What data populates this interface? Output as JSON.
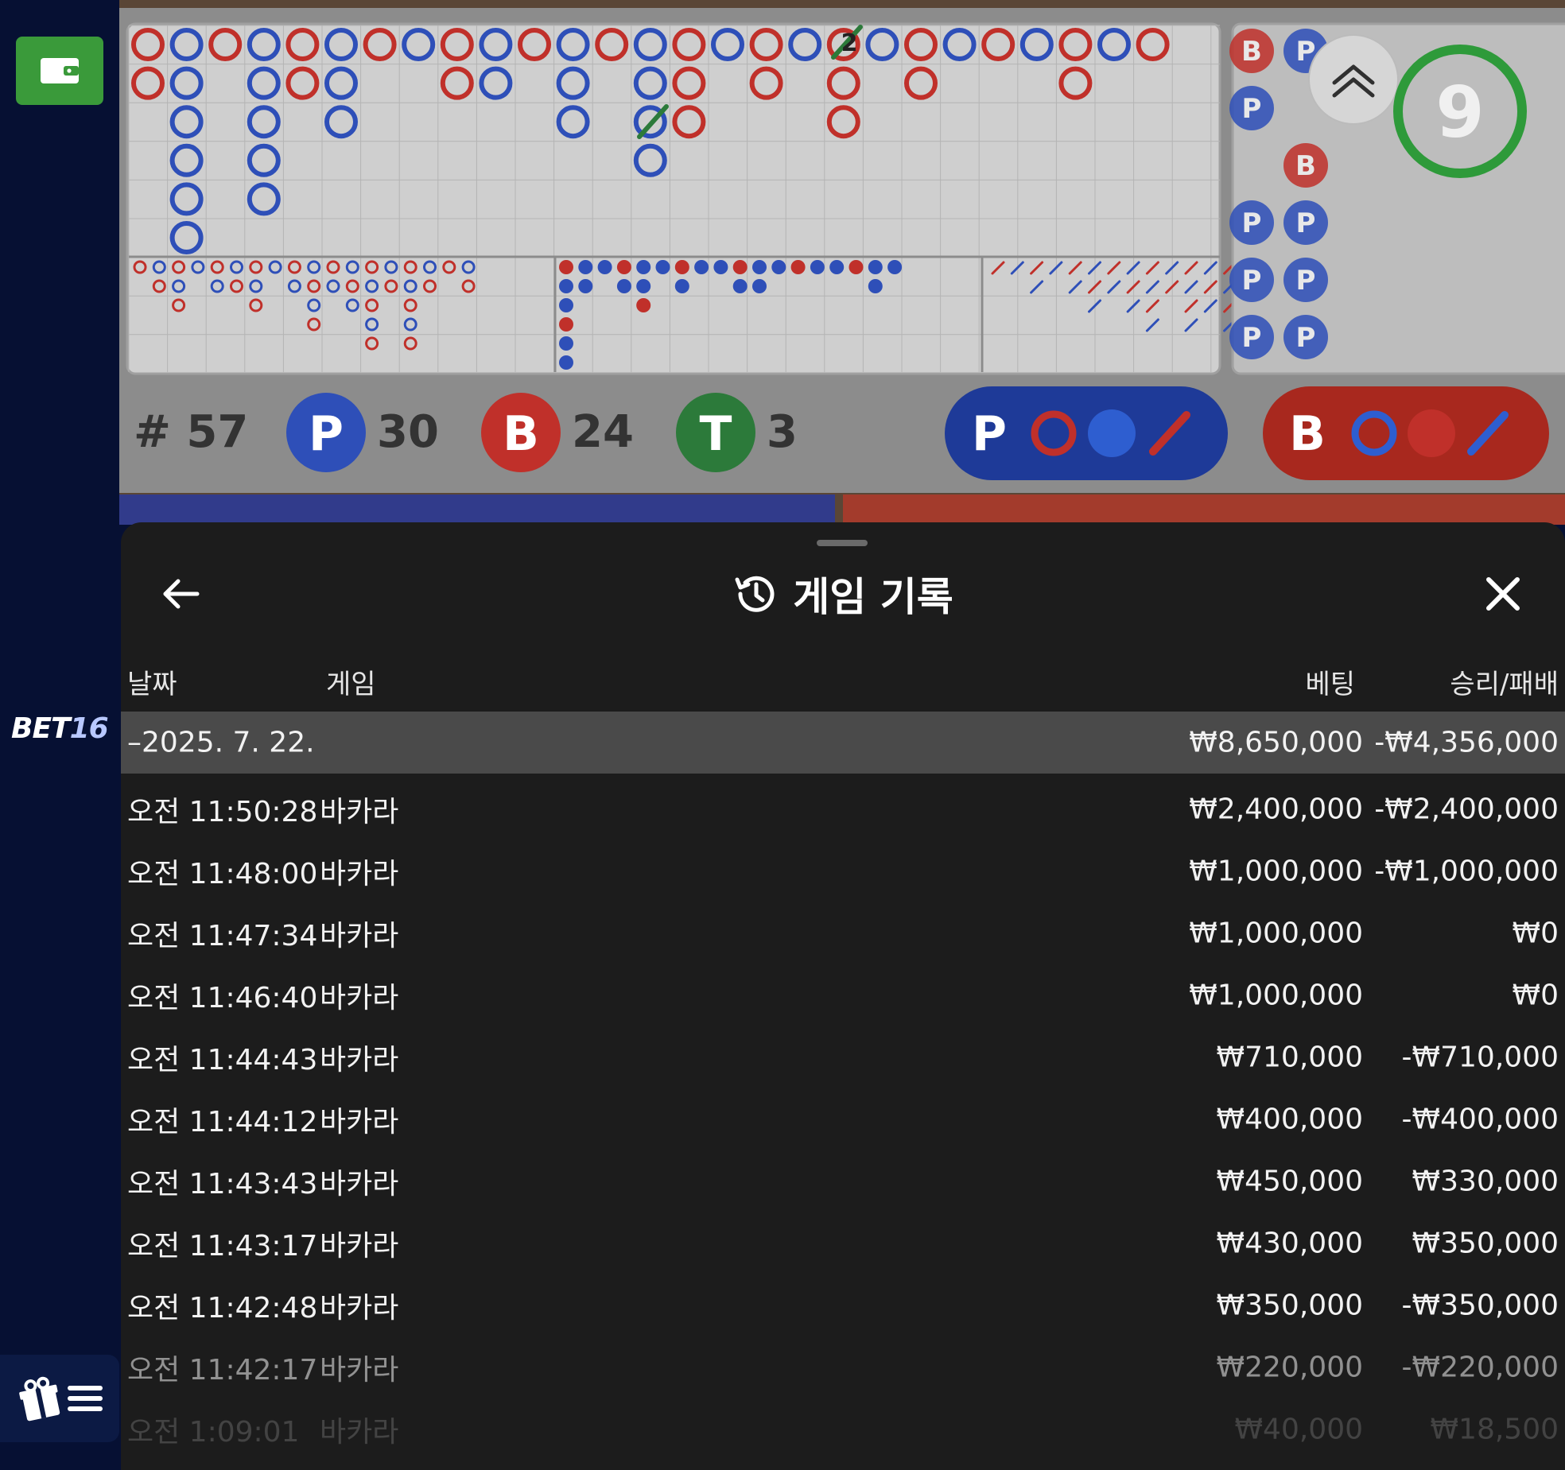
{
  "brand": {
    "name": "BET",
    "number": "16"
  },
  "icons": {
    "wallet": "wallet-icon",
    "promo": "gift-icon",
    "menu": "hamburger-menu-icon",
    "back": "arrow-left-icon",
    "history": "history-clock-icon",
    "close": "close-icon",
    "expand": "chevron-double-up-icon"
  },
  "colors": {
    "player": "#2e4fb8",
    "banker": "#c0302a",
    "tie": "#2c7a3a",
    "wallet": "#3a9a3a",
    "sheet_bg": "#1c1c1c"
  },
  "scoreboard": {
    "round_label": "# 57",
    "player": {
      "letter": "P",
      "count": "30"
    },
    "banker": {
      "letter": "B",
      "count": "24"
    },
    "tie": {
      "letter": "T",
      "count": "3"
    },
    "player_predict": {
      "letter": "P"
    },
    "banker_predict": {
      "letter": "B"
    },
    "timer": "9",
    "tie_count_mark": "2",
    "side_road": [
      "B",
      "P",
      "P",
      "B",
      "P",
      "P",
      "P",
      "P",
      "P",
      "P"
    ]
  },
  "history": {
    "title": "게임 기록",
    "columns": {
      "date": "날짜",
      "game": "게임",
      "bet": "베팅",
      "result": "승리/패배"
    },
    "summary": {
      "date": "–2025. 7. 22.",
      "bet": "₩8,650,000",
      "result": "-₩4,356,000"
    },
    "rows": [
      {
        "time": "오전 11:50:28",
        "game": "바카라",
        "bet": "₩2,400,000",
        "result": "-₩2,400,000"
      },
      {
        "time": "오전 11:48:00",
        "game": "바카라",
        "bet": "₩1,000,000",
        "result": "-₩1,000,000"
      },
      {
        "time": "오전 11:47:34",
        "game": "바카라",
        "bet": "₩1,000,000",
        "result": "₩0"
      },
      {
        "time": "오전 11:46:40",
        "game": "바카라",
        "bet": "₩1,000,000",
        "result": "₩0"
      },
      {
        "time": "오전 11:44:43",
        "game": "바카라",
        "bet": "₩710,000",
        "result": "-₩710,000"
      },
      {
        "time": "오전 11:44:12",
        "game": "바카라",
        "bet": "₩400,000",
        "result": "-₩400,000"
      },
      {
        "time": "오전 11:43:43",
        "game": "바카라",
        "bet": "₩450,000",
        "result": "₩330,000"
      },
      {
        "time": "오전 11:43:17",
        "game": "바카라",
        "bet": "₩430,000",
        "result": "₩350,000"
      },
      {
        "time": "오전 11:42:48",
        "game": "바카라",
        "bet": "₩350,000",
        "result": "-₩350,000"
      },
      {
        "time": "오전 11:42:17",
        "game": "바카라",
        "bet": "₩220,000",
        "result": "-₩220,000"
      },
      {
        "time": "오전 1:09:01",
        "game": "바카라",
        "bet": "₩40,000",
        "result": "₩18,500"
      }
    ]
  }
}
